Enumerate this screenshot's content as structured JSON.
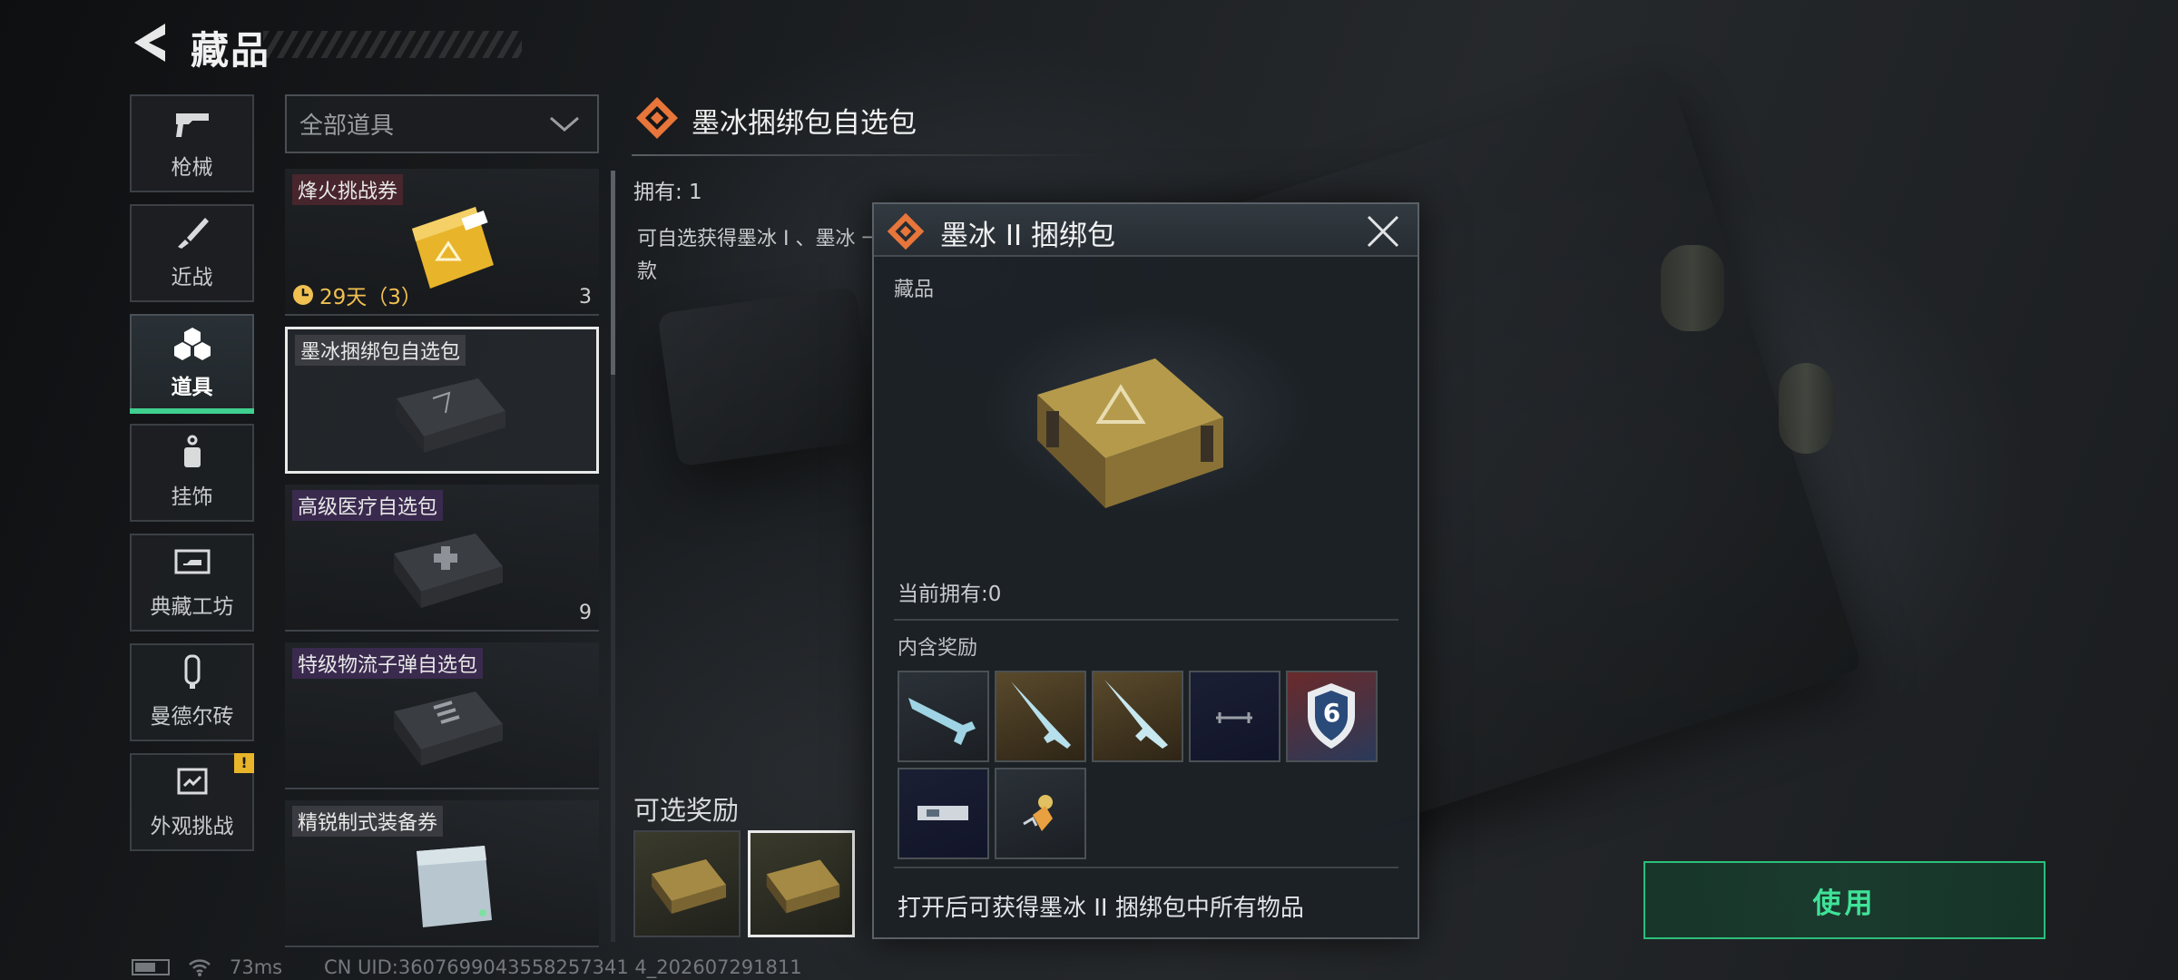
{
  "header": {
    "title": "藏品",
    "back_icon": "back-arrow-icon"
  },
  "nav": {
    "items": [
      {
        "label": "枪械",
        "icon": "gun-icon",
        "active": false
      },
      {
        "label": "近战",
        "icon": "knife-icon",
        "active": false
      },
      {
        "label": "道具",
        "icon": "cubes-icon",
        "active": true
      },
      {
        "label": "挂饰",
        "icon": "charm-icon",
        "active": false
      },
      {
        "label": "典藏工坊",
        "icon": "workshop-icon",
        "active": false
      },
      {
        "label": "曼德尔砖",
        "icon": "brick-icon",
        "active": false
      },
      {
        "label": "外观挑战",
        "icon": "challenge-icon",
        "active": false,
        "alert": "!"
      }
    ]
  },
  "filter": {
    "label": "全部道具"
  },
  "items": [
    {
      "name": "烽火挑战券",
      "timer": "29天（3）",
      "count": "3"
    },
    {
      "name": "墨冰捆绑包自选包",
      "count": ""
    },
    {
      "name": "高级医疗自选包",
      "count": "9"
    },
    {
      "name": "特级物流子弹自选包",
      "count": ""
    },
    {
      "name": "精锐制式装备券",
      "count": ""
    }
  ],
  "detail": {
    "title": "墨冰捆绑包自选包",
    "owned": "拥有: 1",
    "description": "可自选获得墨冰 I 、墨冰 一款",
    "optional_label": "可选奖励"
  },
  "popup": {
    "title": "墨冰 II 捆绑包",
    "category": "藏品",
    "current_owned": "当前拥有:0",
    "contains_label": "内含奖励",
    "footer": "打开后可获得墨冰 II 捆绑包中所有物品",
    "reward_badge": "6"
  },
  "use_button": {
    "label": "使用"
  },
  "status": {
    "ping": "73ms",
    "uid": "CN UID:3607699043558257341 4_202607291811"
  },
  "colors": {
    "accent_green": "#3fe398",
    "selection_white": "#e9e9e9",
    "gold": "#f0c050",
    "diamond_orange": "#e8753a"
  }
}
